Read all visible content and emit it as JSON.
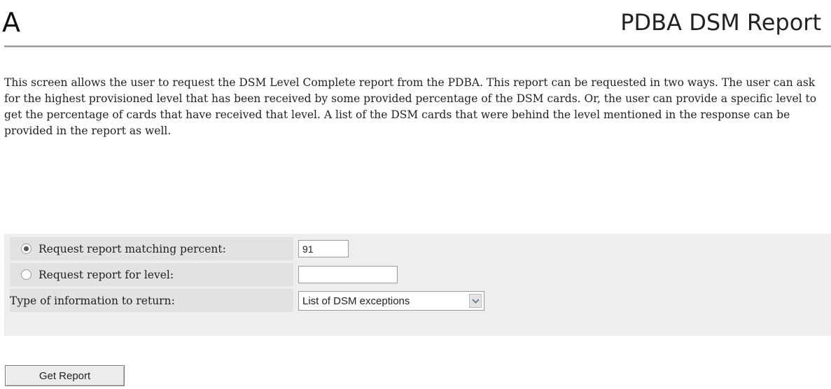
{
  "header": {
    "panel_letter": "A",
    "title": "PDBA DSM Report"
  },
  "description": "This screen allows the user to request the DSM Level Complete report from the PDBA. This report can be requested in two ways. The user can ask for the highest provisioned level that has been received by some provided percentage of the DSM cards. Or, the user can provide a specific level to get the percentage of cards that have received that level. A list of the DSM cards that were behind the level mentioned in the response can be provided in the report as well.",
  "form": {
    "percent_option": {
      "label": "Request report matching percent:",
      "selected": true,
      "value": "91"
    },
    "level_option": {
      "label": "Request report for level:",
      "selected": false,
      "value": ""
    },
    "info_type": {
      "label": "Type of information to return:",
      "selected_value": "List of DSM exceptions"
    },
    "submit_label": "Get Report"
  },
  "icons": {
    "radio": "radio-button-icon",
    "dropdown": "chevron-down-icon"
  },
  "colors": {
    "form_background": "#eeeeee",
    "label_background": "#e2e2e2",
    "rule": "#9a9a9a"
  }
}
